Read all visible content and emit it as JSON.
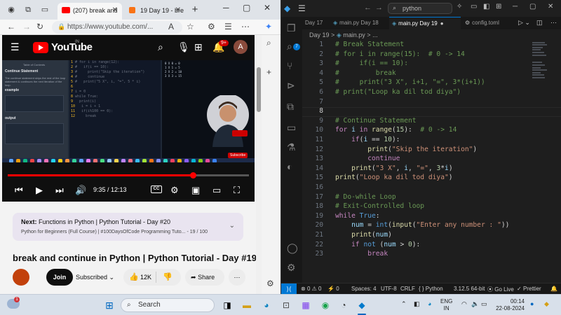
{
  "browser": {
    "tabs": [
      {
        "label": "(207) break and",
        "active": true
      },
      {
        "label": "19 Day 19 - bre",
        "active": false
      }
    ],
    "url": "https://www.youtube.com/...",
    "new_tab_symbol": "+"
  },
  "youtube": {
    "brand": "YouTube",
    "region": "IN",
    "notifications": "9+",
    "avatar_letter": "A",
    "video_frame": {
      "sidebar_title": "Table of Contents",
      "heading": "Continue Statement",
      "desc": "The continue statement skips the rest of the loop statement & continues the next iteration of the loop.",
      "example_label": "example",
      "output_label": "output",
      "code_lines": [
        "# for i in range(12):",
        "#   if(i == 10):",
        "#     print(\"Skip the iteration\")",
        "#     continue",
        "#   print(\"5 X\", i, \"=\", 5 * i)",
        "",
        "i = 0",
        "while True:",
        "  print(i)",
        "  i = i + 1",
        "  if(i%100 == 0):",
        "    break"
      ],
      "subscribe_label": "Subscribe"
    },
    "player": {
      "progress_fraction": 0.766,
      "time": "9:35 / 12:13",
      "cc": "CC"
    },
    "next": {
      "label": "Next:",
      "title": "Functions in Python | Python Tutorial - Day #20",
      "sub": "Python for Beginners (Full Course) | #100DaysOfCode Programming Tuto...",
      "count": "- 19 / 100"
    },
    "title": "break and continue in Python | Python Tutorial - Day #19",
    "join": "Join",
    "subscribed": "Subscribed",
    "likes": "12K",
    "share": "Share",
    "more": "⋯"
  },
  "vscode": {
    "search": "python",
    "tabs": [
      {
        "label": "Day 17",
        "active": false
      },
      {
        "label": "main.py Day 18",
        "active": false
      },
      {
        "label": "main.py Day 19",
        "active": true
      },
      {
        "label": "config.toml",
        "active": false
      }
    ],
    "breadcrumb": [
      "Day 19",
      ">",
      "main.py",
      ">",
      "..."
    ],
    "explorer_badge": "7",
    "current_line": 14,
    "status": {
      "errors": "0",
      "warnings": "0",
      "ports": "0",
      "spaces": "Spaces: 4",
      "encoding": "UTF-8",
      "eol": "CRLF",
      "language": "Python",
      "interpreter": "3.12.5 64-bit",
      "golive": "Go Live",
      "prettier": "Prettier"
    }
  },
  "taskbar": {
    "search": "Search",
    "weather_badge": "1",
    "lang1": "ENG",
    "lang2": "IN",
    "time": "00:14",
    "date": "22-08-2024"
  }
}
